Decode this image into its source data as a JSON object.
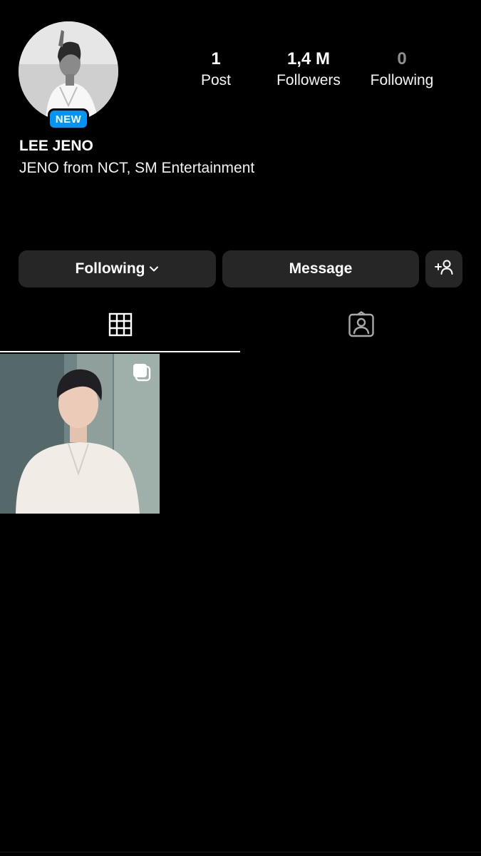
{
  "profile": {
    "badge": "NEW",
    "display_name": "LEE JENO",
    "bio": "JENO from NCT, SM Entertainment"
  },
  "stats": {
    "posts": {
      "value": "1",
      "label": "Post"
    },
    "followers": {
      "value": "1,4 M",
      "label": "Followers"
    },
    "following": {
      "value": "0",
      "label": "Following"
    }
  },
  "actions": {
    "following_label": "Following",
    "message_label": "Message",
    "add_user_icon": "add-person-icon"
  },
  "tabs": [
    {
      "icon": "grid-icon",
      "selected": true
    },
    {
      "icon": "tagged-person-icon",
      "selected": false
    }
  ],
  "posts": [
    {
      "type": "carousel",
      "icon": "multiple-photos-icon"
    }
  ],
  "colors": {
    "background": "#000000",
    "button": "#262626",
    "badge": "#0095f6",
    "muted": "#8e8e8e"
  }
}
